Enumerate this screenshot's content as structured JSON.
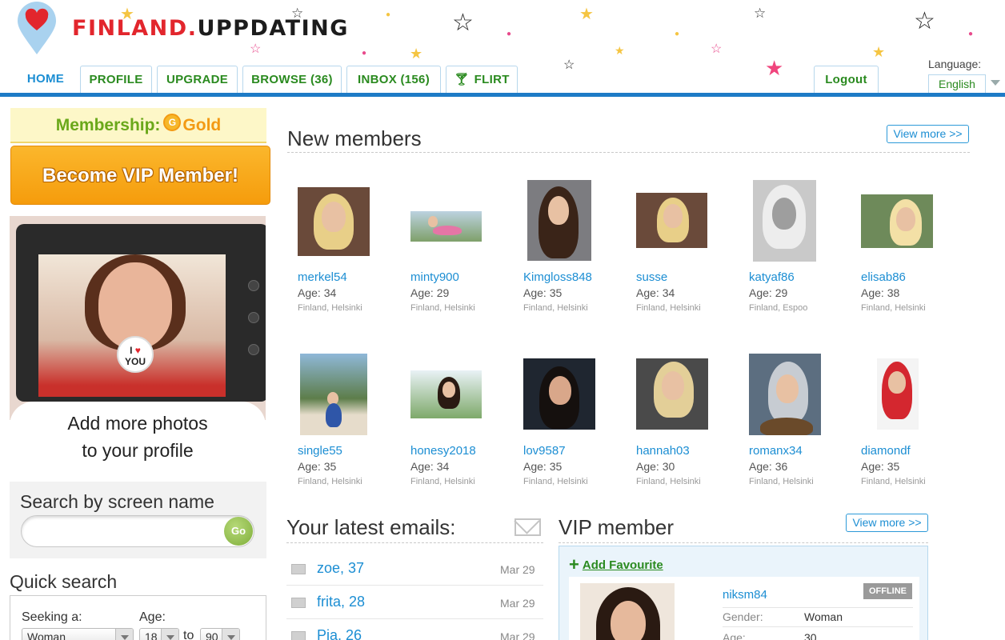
{
  "header": {
    "logo_part1": "FINLAND.",
    "logo_part2": "UPPDATING",
    "nav": [
      {
        "label": "HOME"
      },
      {
        "label": "PROFILE"
      },
      {
        "label": "UPGRADE"
      },
      {
        "label": "BROWSE (36)"
      },
      {
        "label": "INBOX (156)"
      },
      {
        "label": "FLIRT",
        "icon": "cocktail-glass-icon"
      }
    ],
    "logout_label": "Logout",
    "language_label": "Language:",
    "language_value": "English",
    "colors": {
      "accent_blue": "#1e7bc6",
      "nav_green": "#2a8a1f",
      "logo_red": "#e2262d"
    }
  },
  "sidebar": {
    "membership_label": "Membership:",
    "membership_level": "Gold",
    "vip_button": "Become VIP Member!",
    "photo_promo_line1": "Add more photos",
    "photo_promo_line2": "to your profile",
    "badge_top": "I",
    "badge_heart": "♥",
    "badge_bottom": "YOU",
    "search_title": "Search by screen name",
    "search_value": "",
    "go_label": "Go",
    "quick_search_title": "Quick search",
    "seeking_label": "Seeking a:",
    "seeking_value": "Woman",
    "age_label": "Age:",
    "age_from": "18",
    "age_to_label": "to",
    "age_to": "90"
  },
  "new_members": {
    "title": "New members",
    "view_more": "View more >>",
    "members": [
      {
        "name": "merkel54",
        "age": "Age: 34",
        "location": "Finland, Helsinki"
      },
      {
        "name": "minty900",
        "age": "Age: 29",
        "location": "Finland, Helsinki"
      },
      {
        "name": "Kimgloss848",
        "age": "Age: 35",
        "location": "Finland, Helsinki"
      },
      {
        "name": "susse",
        "age": "Age: 34",
        "location": "Finland, Helsinki"
      },
      {
        "name": "katyaf86",
        "age": "Age: 29",
        "location": "Finland, Espoo"
      },
      {
        "name": "elisab86",
        "age": "Age: 38",
        "location": "Finland, Helsinki"
      },
      {
        "name": "single55",
        "age": "Age: 35",
        "location": "Finland, Helsinki"
      },
      {
        "name": "honesy2018",
        "age": "Age: 34",
        "location": "Finland, Helsinki"
      },
      {
        "name": "lov9587",
        "age": "Age: 35",
        "location": "Finland, Helsinki"
      },
      {
        "name": "hannah03",
        "age": "Age: 30",
        "location": "Finland, Helsinki"
      },
      {
        "name": "romanx34",
        "age": "Age: 36",
        "location": "Finland, Helsinki"
      },
      {
        "name": "diamondf",
        "age": "Age: 35",
        "location": "Finland, Helsinki"
      }
    ]
  },
  "emails": {
    "title": "Your latest emails:",
    "items": [
      {
        "from": "zoe, 37",
        "date": "Mar 29"
      },
      {
        "from": "frita, 28",
        "date": "Mar 29"
      },
      {
        "from": "Pia, 26",
        "date": "Mar 29"
      }
    ]
  },
  "vip": {
    "title": "VIP member",
    "view_more": "View more >>",
    "add_favourite": "Add Favourite",
    "name": "niksm84",
    "status": "OFFLINE",
    "gender_label": "Gender:",
    "gender_value": "Woman",
    "age_label": "Age:",
    "age_value": "30"
  }
}
